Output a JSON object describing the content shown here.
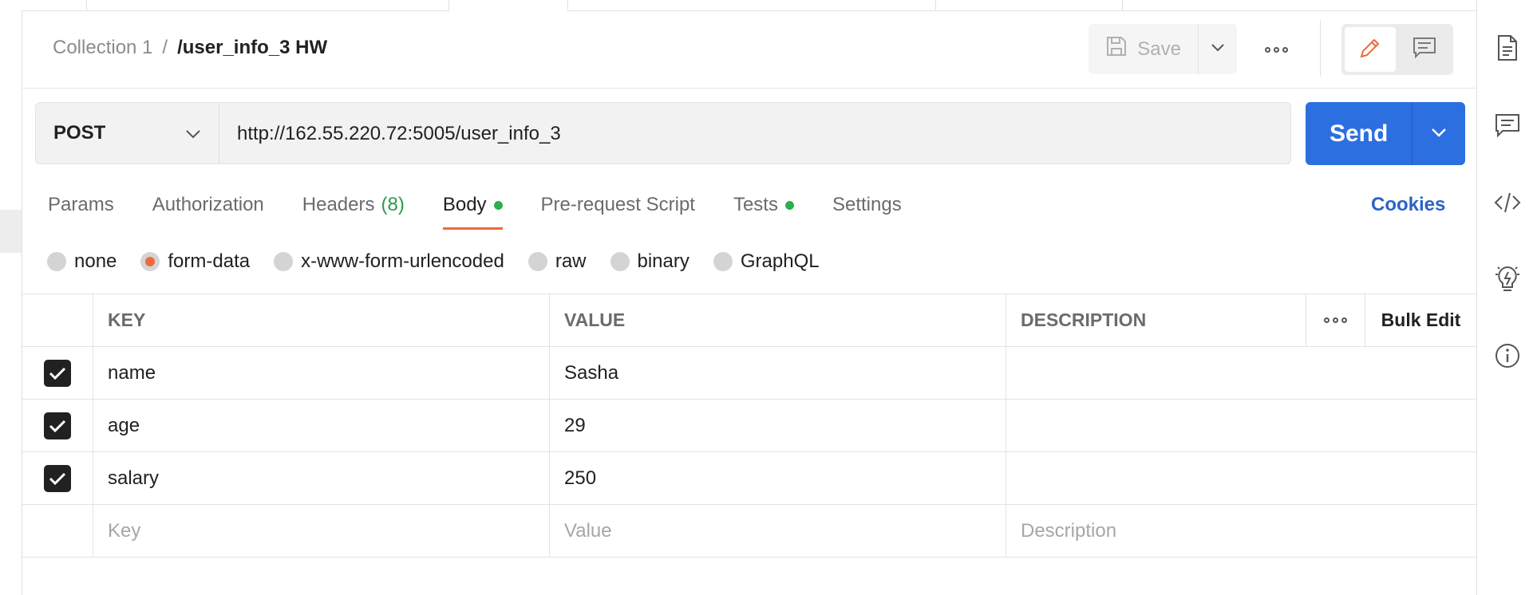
{
  "header": {
    "breadcrumb_parent": "Collection 1",
    "breadcrumb_separator": "/",
    "breadcrumb_current": "/user_info_3 HW",
    "save_label": "Save"
  },
  "request": {
    "method": "POST",
    "url": "http://162.55.220.72:5005/user_info_3",
    "send_label": "Send"
  },
  "tabs": [
    {
      "label": "Params"
    },
    {
      "label": "Authorization"
    },
    {
      "label": "Headers",
      "count": "(8)"
    },
    {
      "label": "Body",
      "active": true,
      "indicator": true
    },
    {
      "label": "Pre-request Script"
    },
    {
      "label": "Tests",
      "indicator": true
    },
    {
      "label": "Settings"
    }
  ],
  "cookies_label": "Cookies",
  "body_types": [
    {
      "label": "none",
      "selected": false
    },
    {
      "label": "form-data",
      "selected": true
    },
    {
      "label": "x-www-form-urlencoded",
      "selected": false
    },
    {
      "label": "raw",
      "selected": false
    },
    {
      "label": "binary",
      "selected": false
    },
    {
      "label": "GraphQL",
      "selected": false
    }
  ],
  "table": {
    "headers": {
      "key": "KEY",
      "value": "VALUE",
      "description": "DESCRIPTION",
      "bulk_edit": "Bulk Edit"
    },
    "rows": [
      {
        "key": "name",
        "value": "Sasha",
        "description": "",
        "checked": true
      },
      {
        "key": "age",
        "value": "29",
        "description": "",
        "checked": true
      },
      {
        "key": "salary",
        "value": "250",
        "description": "",
        "checked": true
      }
    ],
    "placeholders": {
      "key": "Key",
      "value": "Value",
      "description": "Description"
    }
  },
  "colors": {
    "accent": "#ec6b3b",
    "send": "#2c6fe0",
    "indicator": "#2cb04f",
    "cookies": "#2c64c4"
  },
  "icons": [
    "save-icon",
    "chevron-down-icon",
    "more-icon",
    "pencil-icon",
    "comment-icon",
    "document-icon",
    "code-icon",
    "lightbulb-icon",
    "info-icon",
    "check-icon"
  ]
}
